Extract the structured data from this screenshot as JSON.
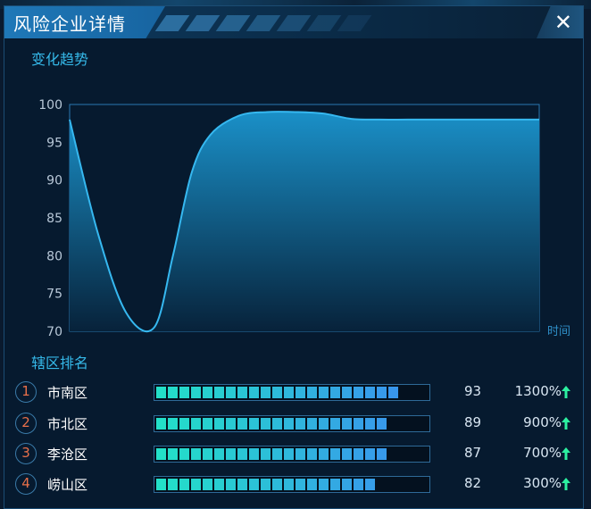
{
  "window": {
    "title": "风险企业详情",
    "close_glyph": "✕"
  },
  "trend": {
    "section_title": "变化趋势",
    "chart_data": {
      "type": "area",
      "ylim": [
        70,
        100
      ],
      "yticks": [
        100,
        95,
        90,
        85,
        80,
        75,
        70
      ],
      "xlabel": "时间",
      "x": [
        0,
        0.06,
        0.12,
        0.18,
        0.22,
        0.26,
        0.3,
        0.36,
        0.42,
        0.48,
        0.54,
        0.6,
        0.66,
        0.72,
        0.8,
        0.9,
        1.0
      ],
      "y": [
        98,
        83,
        72.5,
        70.5,
        80,
        91,
        96,
        98.5,
        99,
        99,
        98.8,
        98.1,
        98,
        98,
        98,
        98,
        98
      ],
      "line_color": "#36b8f0",
      "fill_top": "#1a90c8",
      "fill_bottom": "#07223a"
    }
  },
  "ranking": {
    "section_title": "辖区排名",
    "rows": [
      {
        "rank": "1",
        "name": "市南区",
        "score": "93",
        "fill": 0.93,
        "pct": "1300%"
      },
      {
        "rank": "2",
        "name": "市北区",
        "score": "89",
        "fill": 0.89,
        "pct": "900%"
      },
      {
        "rank": "3",
        "name": "李沧区",
        "score": "87",
        "fill": 0.87,
        "pct": "700%"
      },
      {
        "rank": "4",
        "name": "崂山区",
        "score": "82",
        "fill": 0.82,
        "pct": "300%"
      }
    ],
    "bar_colors": [
      "#23e0c8",
      "#3a8ff0"
    ],
    "up_color": "#2cf0a0"
  }
}
